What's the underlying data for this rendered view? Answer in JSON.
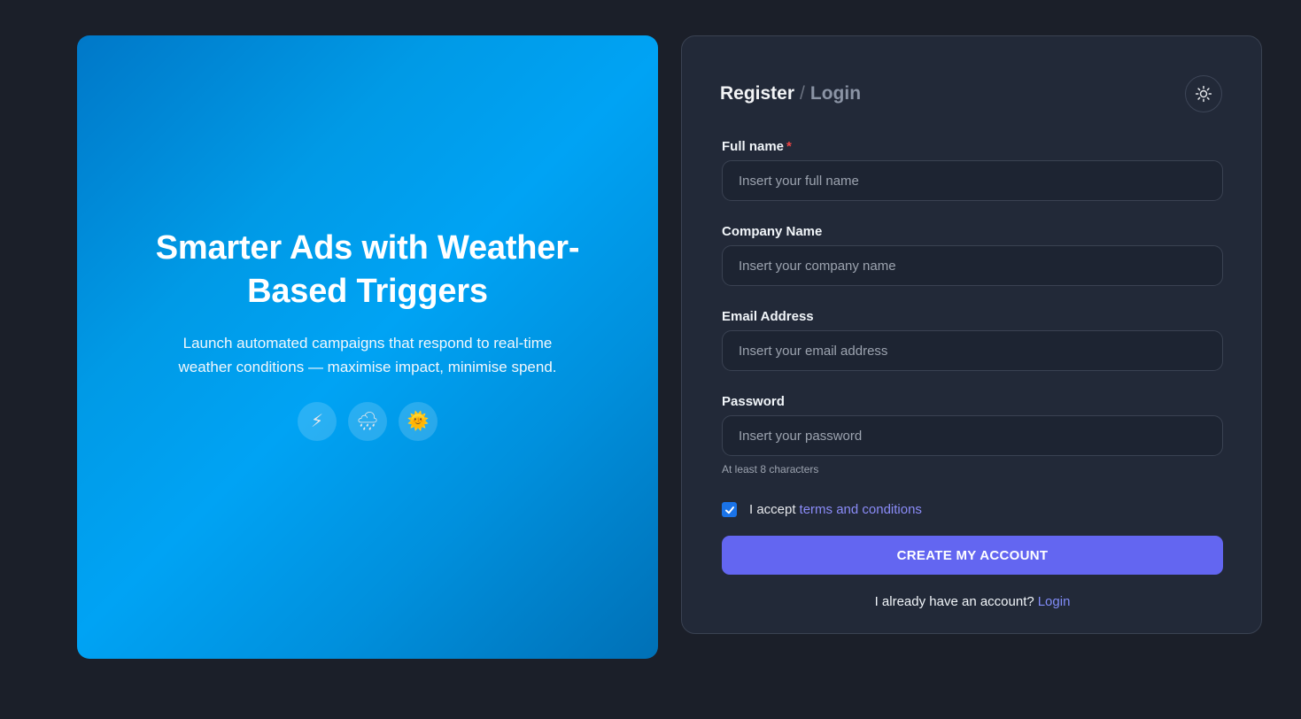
{
  "hero": {
    "title": "Smarter Ads with Weather-Based Triggers",
    "subtitle": "Launch automated campaigns that respond to real-time weather conditions — maximise impact, minimise spend.",
    "badges": [
      {
        "icon": "lightning-icon",
        "glyph": "⚡"
      },
      {
        "icon": "rain-cloud-icon",
        "glyph": "🌧"
      },
      {
        "icon": "sun-icon",
        "glyph": "🌞"
      }
    ]
  },
  "auth": {
    "tab_register": "Register",
    "separator": "/",
    "tab_login": "Login",
    "theme_toggle_icon": "sun-icon"
  },
  "form": {
    "full_name": {
      "label": "Full name",
      "required_mark": "*",
      "placeholder": "Insert your full name",
      "value": ""
    },
    "company": {
      "label": "Company Name",
      "placeholder": "Insert your company name",
      "value": ""
    },
    "email": {
      "label": "Email Address",
      "placeholder": "Insert your email address",
      "value": ""
    },
    "password": {
      "label": "Password",
      "placeholder": "Insert your password",
      "value": "",
      "hint": "At least 8 characters"
    },
    "terms": {
      "prefix": "I accept",
      "link": "terms and conditions",
      "checked": true
    },
    "submit_label": "CREATE MY ACCOUNT",
    "footer_text": "I already have an account?",
    "footer_link": "Login"
  },
  "colors": {
    "background": "#1b1f29",
    "card": "#222938",
    "accent": "#6366f1",
    "link": "#818cf8",
    "hero_gradient_mid": "#00a3f4",
    "required": "#ef4444"
  }
}
